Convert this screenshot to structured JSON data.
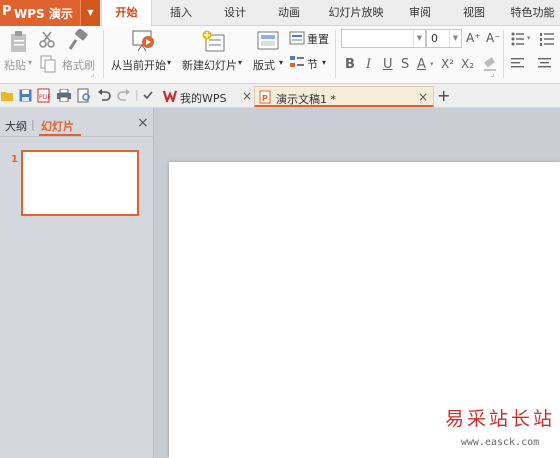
{
  "app": {
    "logo": "P",
    "title": "WPS 演示",
    "dropdown_glyph": "▼"
  },
  "menu_tabs": [
    "开始",
    "插入",
    "设计",
    "动画",
    "幻灯片放映",
    "审阅",
    "视图",
    "特色功能"
  ],
  "ribbon": {
    "paste_label": "粘贴",
    "format_painter_label": "格式刷",
    "from_current_label": "从当前开始",
    "new_slide_label": "新建幻灯片",
    "layout_label": "版式",
    "reset_label": "重置",
    "section_label": "节",
    "font_size_value": "0",
    "grow_font": "A⁺",
    "shrink_font": "A⁻",
    "bold": "B",
    "italic": "I",
    "underline": "U",
    "strike": "S",
    "font_color": "A",
    "superscript": "X²",
    "subscript": "X₂"
  },
  "doc_tabs": [
    {
      "title": "我的WPS",
      "close": "×"
    },
    {
      "title": "演示文稿1 *",
      "close": "×"
    }
  ],
  "add_tab": "+",
  "left_pane": {
    "tab_outline": "大纲",
    "tab_slides": "幻灯片",
    "divider": "|",
    "close": "×",
    "slide_numbers": [
      "1"
    ]
  },
  "watermark": {
    "text": "易采站长站",
    "url": "www.easck.com"
  },
  "colors": {
    "accent": "#e0632f",
    "ribbon_bg": "#fafafa",
    "pane_bg": "#d4d7dd",
    "canvas_bg": "#c9ccd3"
  }
}
